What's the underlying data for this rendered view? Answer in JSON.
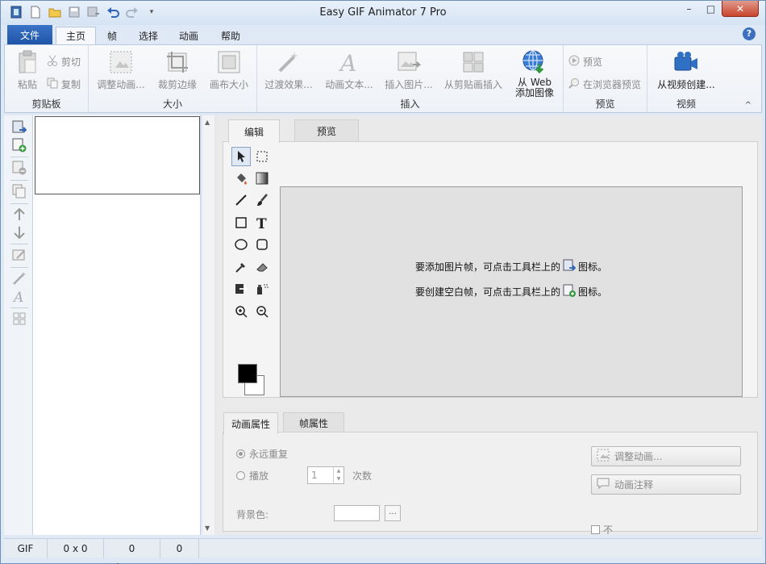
{
  "app": {
    "title": "Easy GIF Animator 7 Pro"
  },
  "quick_access": [
    {
      "icon": "app-logo-icon"
    },
    {
      "icon": "new-file-icon"
    },
    {
      "icon": "open-folder-icon"
    },
    {
      "icon": "save-icon"
    },
    {
      "icon": "save-as-icon"
    },
    {
      "icon": "undo-icon"
    },
    {
      "icon": "redo-icon"
    },
    {
      "icon": "customize-dropdown-icon"
    }
  ],
  "window_controls": {
    "minimize": "–",
    "maximize": "□",
    "close": "✕"
  },
  "ribbon_tabs": {
    "file": "文件",
    "home": "主页",
    "frame": "帧",
    "select": "选择",
    "animation": "动画",
    "help": "帮助"
  },
  "help_icon": "?",
  "ribbon": {
    "clipboard": {
      "label": "剪贴板",
      "paste": "粘贴",
      "cut": "剪切",
      "copy": "复制"
    },
    "size": {
      "label": "大小",
      "resize": "调整动画...",
      "crop": "裁剪边缘",
      "canvas": "画布大小"
    },
    "insert": {
      "label": "插入",
      "transition": "过渡效果...",
      "animated_text": "动画文本...",
      "insert_image": "插入图片...",
      "from_clipboard": "从剪贴画插入",
      "from_web_line1": "从 Web",
      "from_web_line2": "添加图像"
    },
    "preview": {
      "label": "预览",
      "preview": "预览",
      "browser_preview": "在浏览器预览"
    },
    "video": {
      "label": "视频",
      "from_video": "从视频创建..."
    },
    "collapse_icon": "^"
  },
  "editor": {
    "tabs": {
      "edit": "编辑",
      "preview": "预览"
    },
    "message_add_frame_before": "要添加图片帧，可点击工具栏上的",
    "message_add_frame_after": "图标。",
    "message_blank_frame_before": "要创建空白帧，可点击工具栏上的",
    "message_blank_frame_after": "图标。"
  },
  "properties": {
    "tabs": {
      "animation": "动画属性",
      "frame": "帧属性"
    },
    "repeat_forever": "永远重复",
    "play": "播放",
    "play_count": "1",
    "times": "次数",
    "background_color": "背景色:",
    "color_button": "...",
    "resize_animation": "调整动画...",
    "animation_comment": "动画注释",
    "checkbox_label": "不"
  },
  "status": {
    "format": "GIF 89a",
    "dimensions": "0 x 0",
    "frames": "0 frames",
    "duration": "0 sec"
  },
  "colors": {
    "accent": "#1f55a8",
    "ribbon_bg": "#f3f5f9",
    "canvas_bg": "#e1e1e1",
    "foreground_color": "#000000",
    "background_color": "#ffffff"
  }
}
